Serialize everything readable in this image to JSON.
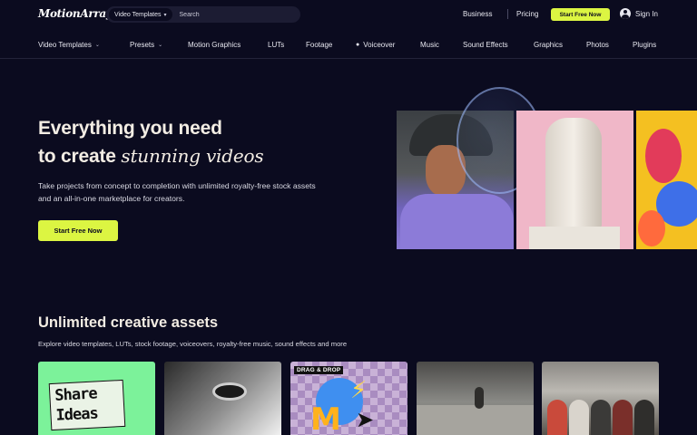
{
  "header": {
    "logo": "MotionArray",
    "search": {
      "category": "Video Templates",
      "placeholder": "Search"
    },
    "links": {
      "business": "Business",
      "pricing": "Pricing"
    },
    "cta": "Start Free Now",
    "signin": "Sign In"
  },
  "nav": {
    "items": [
      {
        "label": "Video Templates",
        "dropdown": true
      },
      {
        "label": "Presets",
        "dropdown": true
      },
      {
        "label": "Motion Graphics"
      },
      {
        "label": "LUTs"
      },
      {
        "label": "Footage"
      },
      {
        "label": "Voiceover",
        "icon": "microphone-icon"
      },
      {
        "label": "Music"
      },
      {
        "label": "Sound Effects"
      },
      {
        "label": "Graphics"
      },
      {
        "label": "Photos"
      },
      {
        "label": "Plugins"
      }
    ]
  },
  "hero": {
    "title_line1": "Everything you need",
    "title_line2_plain": "to create ",
    "title_line2_italic": "stunning videos",
    "subtitle": "Take projects from concept to completion with unlimited royalty-free stock assets and an all-in-one marketplace for creators.",
    "cta": "Start Free Now"
  },
  "assets": {
    "title": "Unlimited creative assets",
    "subtitle": "Explore video templates, LUTs, stock footage, voiceovers, royalty-free music, sound effects and more",
    "cards": [
      {
        "text_line1": "Share",
        "text_line2": "Ideas"
      },
      {},
      {
        "badge": "DRAG & DROP"
      },
      {},
      {}
    ]
  },
  "colors": {
    "background": "#0b0b1f",
    "accent": "#dcf542",
    "heading": "#f3ede4"
  }
}
